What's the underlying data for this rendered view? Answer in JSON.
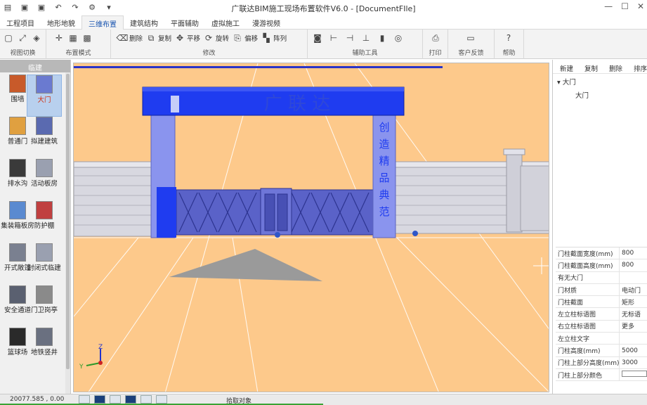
{
  "window": {
    "title": "广联达BIM施工现场布置软件V6.0 - [DocumentFIle]",
    "min_glyph": "—",
    "max_glyph": "☐",
    "close_glyph": "✕"
  },
  "quick_access": [
    {
      "name": "app-menu-icon",
      "glyph": "▤"
    },
    {
      "name": "save-icon",
      "glyph": "▣"
    },
    {
      "name": "save-as-icon",
      "glyph": "▣"
    },
    {
      "name": "undo-icon",
      "glyph": "↶"
    },
    {
      "name": "redo-icon",
      "glyph": "↷"
    },
    {
      "name": "settings-icon",
      "glyph": "⚙"
    },
    {
      "name": "dropdown-icon",
      "glyph": "▾"
    }
  ],
  "tabs": [
    "工程项目",
    "地形地貌",
    "三维布置",
    "建筑结构",
    "平面辅助",
    "虚拟施工",
    "漫游视频"
  ],
  "active_tab": 2,
  "ribbon": {
    "groups": {
      "view_switch": "视图切换",
      "layout_mode": "布置模式",
      "modify": "修改",
      "aux_tools": "辅助工具",
      "print": "打印",
      "feedback": "客户反馈",
      "help": "帮助"
    },
    "modify_buttons": [
      "删除",
      "复制",
      "平移",
      "旋转",
      "偏移",
      "阵列"
    ]
  },
  "palette": {
    "header": "临建",
    "items": [
      {
        "label": "围墙",
        "icon": "wall-icon"
      },
      {
        "label": "大门",
        "icon": "gate-icon",
        "selected": true
      },
      {
        "label": "普通门",
        "icon": "door-icon"
      },
      {
        "label": "拟建建筑",
        "icon": "building-icon"
      },
      {
        "label": "排水沟",
        "icon": "drain-icon"
      },
      {
        "label": "活动板房",
        "icon": "prefab-house-icon"
      },
      {
        "label": "集装箱板房",
        "icon": "container-house-icon"
      },
      {
        "label": "防护棚",
        "icon": "shelter-icon"
      },
      {
        "label": "开式敞篷",
        "icon": "open-shed-icon"
      },
      {
        "label": "封闭式临建",
        "icon": "closed-building-icon"
      },
      {
        "label": "安全通道",
        "icon": "safety-passage-icon"
      },
      {
        "label": "门卫岗亭",
        "icon": "guard-booth-icon"
      },
      {
        "label": "篮球场",
        "icon": "basketball-court-icon"
      },
      {
        "label": "地铁竖井",
        "icon": "metro-shaft-icon"
      }
    ]
  },
  "scene": {
    "gate_sign": "广 联 达",
    "pillar_text": [
      "创",
      "造",
      "精",
      "品",
      "典",
      "范"
    ],
    "colors": {
      "ground": "#fdc98b",
      "gate_blue": "#1f3cf0",
      "pillar_light": "#8a94ee",
      "wall": "#d8d8e0"
    },
    "axes": {
      "z": "Z",
      "y": "Y"
    }
  },
  "right_panel": {
    "toolbar": [
      "新建",
      "复制",
      "删除",
      "排序"
    ],
    "tree": {
      "parent": "大门",
      "child": "大门"
    },
    "properties": [
      {
        "key": "门柱截面宽度(mm)",
        "value": "800"
      },
      {
        "key": "门柱截面高度(mm)",
        "value": "800"
      },
      {
        "key": "有无大门",
        "value": ""
      },
      {
        "key": "门材质",
        "value": "电动门"
      },
      {
        "key": "门柱截面",
        "value": "矩形"
      },
      {
        "key": "左立柱标语图",
        "value": "无标语"
      },
      {
        "key": "右立柱标语图",
        "value": "更多"
      },
      {
        "key": "左立柱文字",
        "value": ""
      },
      {
        "key": "门柱高度(mm)",
        "value": "5000"
      },
      {
        "key": "门柱上部分高度(mm)",
        "value": "3000"
      },
      {
        "key": "门柱上部分颜色",
        "value": ""
      }
    ]
  },
  "status": {
    "coords": "20077.585 , 0.00",
    "message": "拾取对象"
  }
}
